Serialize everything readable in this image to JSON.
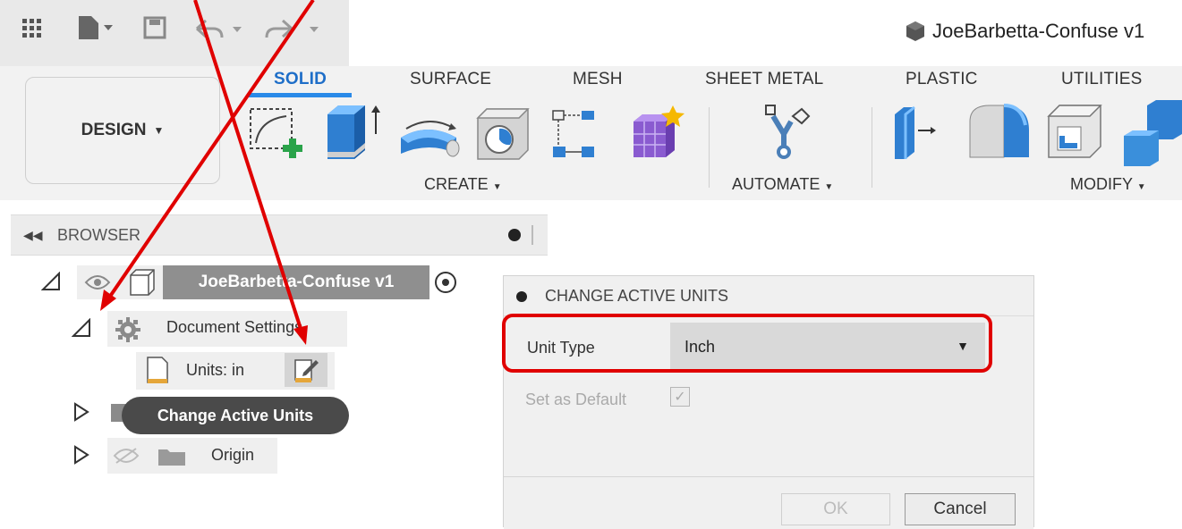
{
  "window": {
    "document_title": "JoeBarbetta-Confuse v1"
  },
  "ribbon": {
    "workspace_label": "DESIGN",
    "tabs": [
      "SOLID",
      "SURFACE",
      "MESH",
      "SHEET METAL",
      "PLASTIC",
      "UTILITIES"
    ],
    "active_tab": "SOLID",
    "groups": {
      "create": "CREATE",
      "automate": "AUTOMATE",
      "modify": "MODIFY"
    }
  },
  "browser": {
    "title": "BROWSER",
    "root_name": "JoeBarbetta-Confuse v1",
    "document_settings_label": "Document Settings",
    "units_label": "Units: in",
    "tooltip": "Change Active Units",
    "origin_label": "Origin"
  },
  "dialog": {
    "title": "CHANGE ACTIVE UNITS",
    "unit_type_label": "Unit Type",
    "unit_type_value": "Inch",
    "set_default_label": "Set as Default",
    "ok_label": "OK",
    "cancel_label": "Cancel"
  },
  "colors": {
    "annotation": "#e00000",
    "active_tab": "#1e6ec8",
    "tool_blue": "#3a8fdb"
  }
}
